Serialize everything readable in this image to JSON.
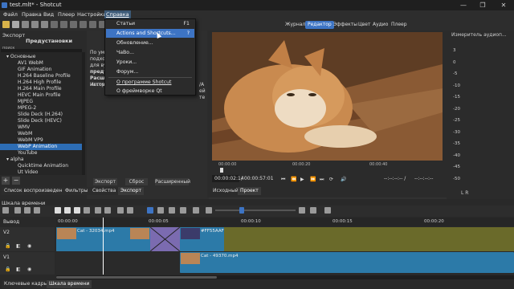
{
  "window": {
    "title": "test.mlt* - Shotcut",
    "controls": [
      "—",
      "❐",
      "✕"
    ]
  },
  "menubar": {
    "items": [
      "Файл",
      "Правка",
      "Вид",
      "Плеер",
      "Настройки",
      "Справка"
    ]
  },
  "top_tabs": [
    "Журнал",
    "Редактор",
    "Эффекты",
    "Цвет",
    "Аудио",
    "Плеер"
  ],
  "help_menu": {
    "items": [
      {
        "label": "Статьи",
        "shortcut": "F1"
      },
      {
        "label": "Actions and Shortcuts...",
        "shortcut": "?"
      },
      {
        "label": "Обновление...",
        "shortcut": ""
      },
      {
        "label": "ЧаВо...",
        "shortcut": ""
      },
      {
        "label": "Уроки...",
        "shortcut": ""
      },
      {
        "label": "Форум...",
        "shortcut": ""
      },
      {
        "label": "О программе Shotcut",
        "shortcut": ""
      },
      {
        "label": "О фреймворке Qt",
        "shortcut": ""
      }
    ]
  },
  "export_panel": {
    "header": "Экспорт",
    "presets_title": "Предустановки",
    "search_label": "поиск",
    "presets": [
      {
        "label": "Основные",
        "group": true
      },
      {
        "label": "AV1 WebM"
      },
      {
        "label": "GIF Animation"
      },
      {
        "label": "H.264 Baseline Profile"
      },
      {
        "label": "H.264 High Profile"
      },
      {
        "label": "H.264 Main Profile"
      },
      {
        "label": "HEVC Main Profile"
      },
      {
        "label": "MJPEG"
      },
      {
        "label": "MPEG-2"
      },
      {
        "label": "Slide Deck (H.264)"
      },
      {
        "label": "Slide Deck (HEVC)"
      },
      {
        "label": "WMV"
      },
      {
        "label": "WebM"
      },
      {
        "label": "WebM VP9"
      },
      {
        "label": "WebP Animation",
        "selected": true
      },
      {
        "label": "YouTube"
      },
      {
        "label": "alpha",
        "group": true
      },
      {
        "label": "Quicktime Animation"
      },
      {
        "label": "Ut Video"
      }
    ],
    "mid_text": [
      "По умол",
      "подходе",
      "для ву",
      "предуст",
      "Расшир",
      "настрой",
      "Источн"
    ],
    "mid_suffix": [
      "/A",
      "ей",
      "те"
    ],
    "buttons": [
      "Экспорт",
      "Сброс",
      "Расширенный"
    ]
  },
  "left_tabs": [
    "Список воспроизведения",
    "Фильтры",
    "Свойства",
    "Экспорт"
  ],
  "player": {
    "ruler_labels": [
      "00:00:00",
      "00:00:20",
      "00:00:40"
    ],
    "position": "00:00:02:14",
    "duration": "/ 00:00:57:01",
    "in_point": "--:--:--:-- /",
    "out_point": "--:--:--:--",
    "tabs": [
      "Исходный",
      "Проект"
    ]
  },
  "meter": {
    "title": "Измеритель аудиоп...",
    "ticks": [
      "3",
      "0",
      "-5",
      "-10",
      "-15",
      "-20",
      "-25",
      "-30",
      "-35",
      "-40",
      "-45",
      "-50"
    ],
    "lr": "L  R"
  },
  "timeline": {
    "title": "Шкала времени",
    "output_label": "Вывод",
    "ruler": [
      "00:00:00",
      "00:00:05",
      "00:00:10",
      "00:00:15",
      "00:00:20"
    ],
    "tracks": [
      {
        "name": "V2"
      },
      {
        "name": "V1"
      }
    ],
    "clips": {
      "v2a": "Cat - 32034.mp4",
      "v2b": "#FF55AAFF",
      "v1": "Cat - 49370.mp4"
    }
  },
  "bottom_tabs": [
    "Ключевые кадры",
    "Шкала времени"
  ]
}
